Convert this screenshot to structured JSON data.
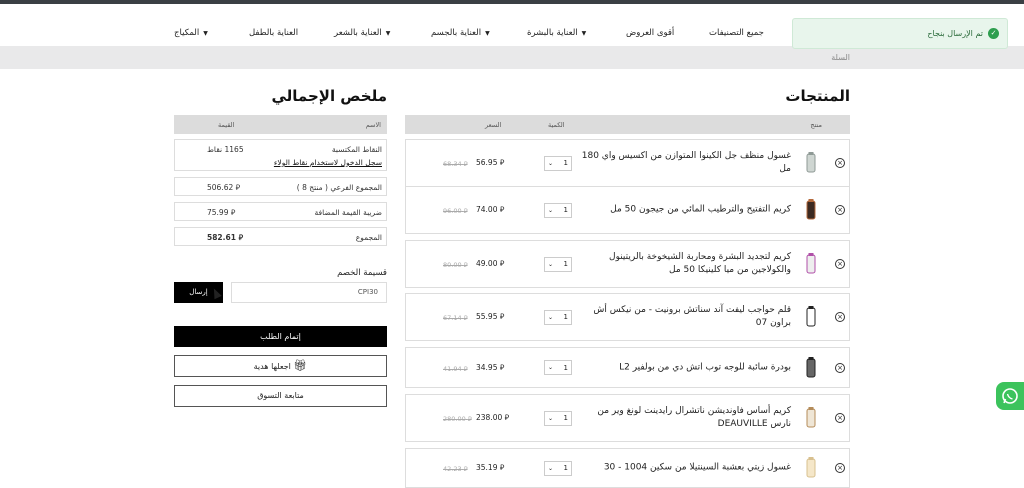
{
  "nav": {
    "items": [
      {
        "label": "جميع التصنيفات",
        "caret": false
      },
      {
        "label": "أقوى العروض",
        "caret": false
      },
      {
        "label": "العناية بالبشرة",
        "caret": true
      },
      {
        "label": "العناية بالجسم",
        "caret": true
      },
      {
        "label": "العناية بالشعر",
        "caret": true
      },
      {
        "label": "العناية بالطفل",
        "caret": false
      },
      {
        "label": "المكياج",
        "caret": true
      }
    ]
  },
  "toast": {
    "text": "تم الإرسال بنجاح"
  },
  "breadcrumb": {
    "text": "السلة"
  },
  "products": {
    "title": "المنتجات",
    "headers": {
      "product": "منتج",
      "qty": "الكمية",
      "price": "السعر"
    },
    "items": [
      {
        "name": "غسول منظف جل الكينوا المتوازن من اكسيس واي 180 مل",
        "qty": "1",
        "price": "56.95",
        "old": "68.34"
      },
      {
        "name": "كريم التفتيح والترطيب المائي من جيجون 50 مل",
        "qty": "1",
        "price": "74.00",
        "old": "96.00"
      },
      {
        "name": "كريم لتجديد البشرة ومحاربة الشيخوخة بالريتينول والكولاجين من ميا كلينيكا 50 مل",
        "qty": "1",
        "price": "49.00",
        "old": "80.00"
      },
      {
        "name": "قلم حواجب ليفت آند سناتش برونيت - من نيكس أش براون 07",
        "qty": "1",
        "price": "55.95",
        "old": "67.14"
      },
      {
        "name": "بودرة سائبة للوجه توب اتش دي من بولفير L2",
        "qty": "1",
        "price": "34.95",
        "old": "41.94"
      },
      {
        "name": "كريم أساس فاونديشن ناتشرال رايدينت لونغ وير من نارس DEAUVILLE",
        "qty": "1",
        "price": "238.00",
        "old": "280.00"
      },
      {
        "name": "غسول زيتي بعشبة السينتيلا من سكين 1004 - 30",
        "qty": "1",
        "price": "35.19",
        "old": "42.23"
      }
    ]
  },
  "summary": {
    "title": "ملخص الإجمالي",
    "headers": {
      "name": "الاسم",
      "value": "القيمة"
    },
    "points_label": "النقاط المكتسبة",
    "points_value": "1165 نقاط",
    "points_link": "سجل الدخول لاستخدام نقاط الولاء",
    "subtotal_label": "المجموع الفرعي ( منتج 8 )",
    "subtotal_value": "506.62",
    "vat_label": "ضريبة القيمة المضافة",
    "vat_value": "75.99",
    "total_label": "المجموع",
    "total_value": "582.61",
    "currency": "⃁"
  },
  "coupon": {
    "label": "قسيمة الخصم",
    "value": "CPI30",
    "button": "إرسال"
  },
  "actions": {
    "checkout": "إتمام الطلب",
    "gift": "اجعلها هدية",
    "continue": "متابعة التسوق"
  },
  "colors": {
    "accent": "#000000",
    "success": "#2e9e4f",
    "whatsapp": "#3cc35c"
  }
}
